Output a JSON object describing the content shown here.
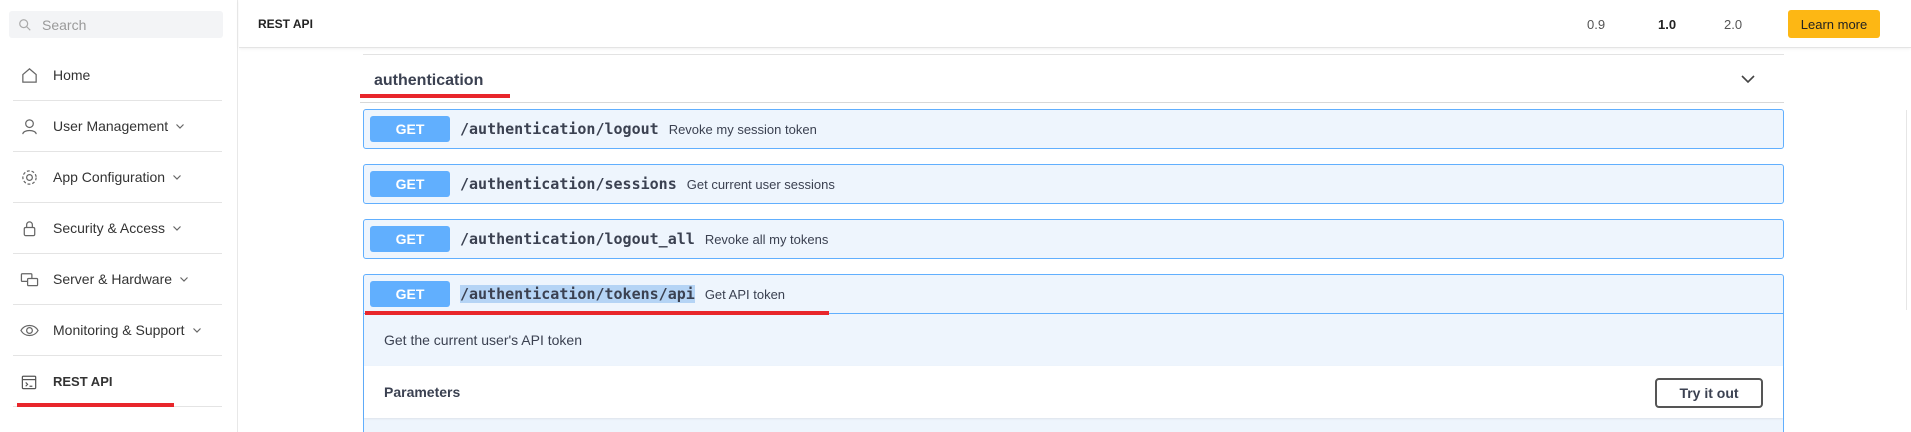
{
  "sidebar": {
    "search_placeholder": "Search",
    "items": [
      {
        "label": "Home",
        "icon": "home-icon",
        "has_chevron": false
      },
      {
        "label": "User Management",
        "icon": "user-icon",
        "has_chevron": true
      },
      {
        "label": "App Configuration",
        "icon": "gear-icon",
        "has_chevron": true
      },
      {
        "label": "Security & Access",
        "icon": "lock-icon",
        "has_chevron": true
      },
      {
        "label": "Server & Hardware",
        "icon": "server-icon",
        "has_chevron": true
      },
      {
        "label": "Monitoring & Support",
        "icon": "eye-icon",
        "has_chevron": true
      },
      {
        "label": "REST API",
        "icon": "api-icon",
        "has_chevron": false,
        "active": true
      }
    ]
  },
  "topbar": {
    "title": "REST API",
    "versions": [
      "0.9",
      "1.0",
      "2.0"
    ],
    "selected_version": "1.0",
    "learn_more": "Learn more"
  },
  "section": {
    "tag": "authentication",
    "operations": [
      {
        "method": "GET",
        "path": "/authentication/logout",
        "summary": "Revoke my session token"
      },
      {
        "method": "GET",
        "path": "/authentication/sessions",
        "summary": "Get current user sessions"
      },
      {
        "method": "GET",
        "path": "/authentication/logout_all",
        "summary": "Revoke all my tokens"
      },
      {
        "method": "GET",
        "path": "/authentication/tokens/api",
        "summary": "Get API token",
        "expanded": true,
        "description": "Get the current user's API token",
        "parameters_label": "Parameters",
        "try_label": "Try it out"
      }
    ]
  },
  "colors": {
    "accent_red": "#e8262b",
    "get_blue": "#61affe",
    "learn_more_yellow": "#fdb714"
  }
}
